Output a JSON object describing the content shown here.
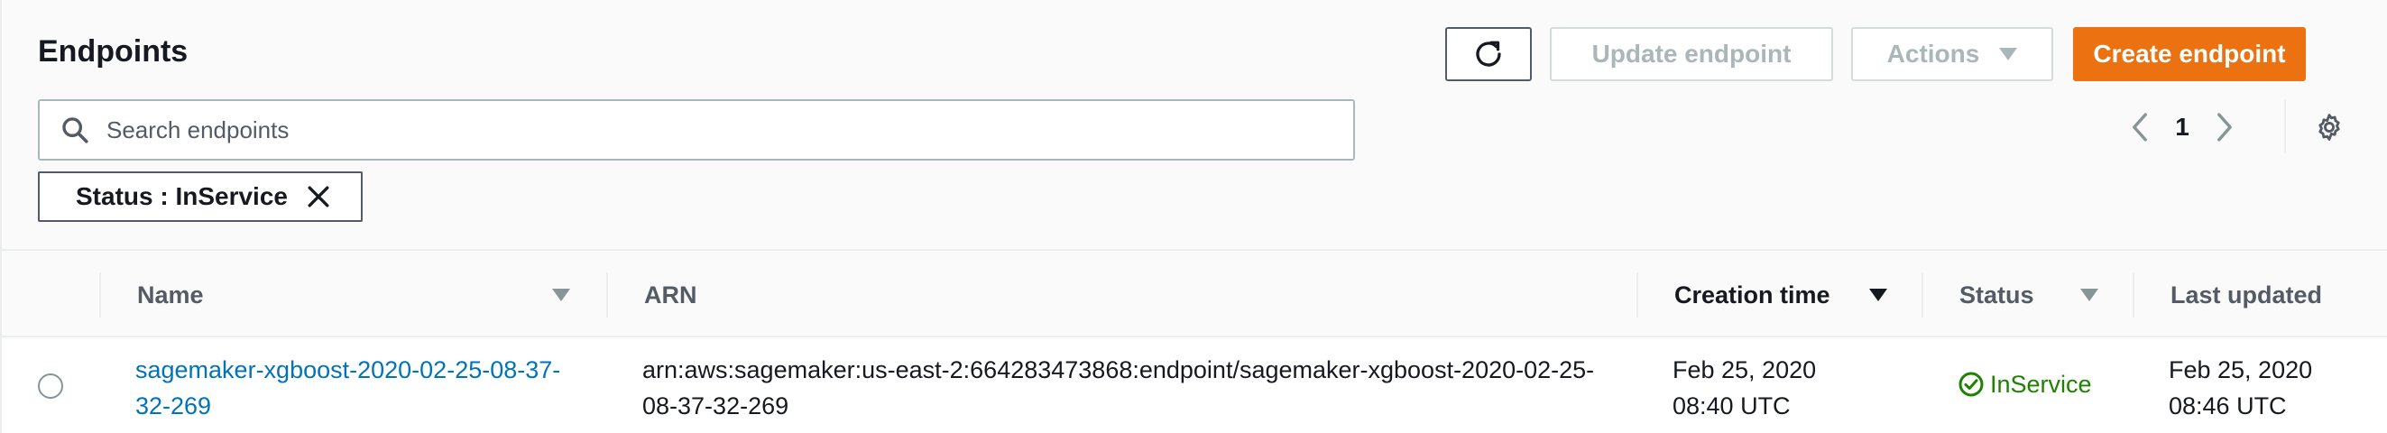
{
  "header": {
    "title": "Endpoints",
    "update_label": "Update endpoint",
    "actions_label": "Actions",
    "create_label": "Create endpoint"
  },
  "search": {
    "placeholder": "Search endpoints",
    "value": ""
  },
  "pagination": {
    "current_page": "1"
  },
  "filter": {
    "chip_label": "Status : InService"
  },
  "table": {
    "columns": {
      "name": "Name",
      "arn": "ARN",
      "creation_time": "Creation time",
      "status": "Status",
      "last_updated": "Last updated"
    },
    "rows": [
      {
        "name": "sagemaker-xgboost-2020-02-25-08-37-32-269",
        "arn": "arn:aws:sagemaker:us-east-2:664283473868:endpoint/sagemaker-xgboost-2020-02-25-08-37-32-269",
        "creation_time": "Feb 25, 2020 08:40 UTC",
        "status": "InService",
        "last_updated": "Feb 25, 2020 08:46 UTC"
      }
    ]
  },
  "colors": {
    "primary": "#ec7211",
    "link": "#0073bb",
    "success": "#1d8102",
    "disabled": "#aab7b8"
  },
  "icons": [
    "refresh-icon",
    "caret-down-icon",
    "search-icon",
    "chevron-left-icon",
    "chevron-right-icon",
    "gear-icon",
    "close-icon",
    "sort-down-icon",
    "check-circle-icon"
  ]
}
